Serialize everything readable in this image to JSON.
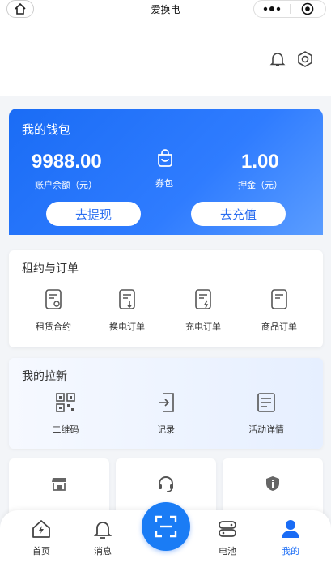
{
  "navbar": {
    "title": "爱换电"
  },
  "wallet": {
    "title": "我的钱包",
    "balance_value": "9988.00",
    "balance_label": "账户余额（元）",
    "coupon_label": "券包",
    "deposit_value": "1.00",
    "deposit_label": "押金（元）",
    "withdraw_label": "去提现",
    "recharge_label": "去充值"
  },
  "orders": {
    "title": "租约与订单",
    "items": [
      {
        "label": "租赁合约",
        "icon": "contract-icon"
      },
      {
        "label": "换电订单",
        "icon": "swap-order-icon"
      },
      {
        "label": "充电订单",
        "icon": "charge-order-icon"
      },
      {
        "label": "商品订单",
        "icon": "goods-order-icon"
      }
    ]
  },
  "invite": {
    "title": "我的拉新",
    "items": [
      {
        "label": "二维码",
        "icon": "qrcode-icon"
      },
      {
        "label": "记录",
        "icon": "record-icon"
      },
      {
        "label": "活动详情",
        "icon": "activity-detail-icon"
      }
    ]
  },
  "shortcuts": [
    {
      "icon": "store-icon"
    },
    {
      "icon": "headset-icon"
    },
    {
      "icon": "info-icon"
    }
  ],
  "tabbar": {
    "items": [
      {
        "label": "首页",
        "icon": "home-icon"
      },
      {
        "label": "消息",
        "icon": "bell-icon"
      },
      {
        "label": "电池",
        "icon": "battery-icon"
      },
      {
        "label": "我的",
        "icon": "user-icon",
        "active": true
      }
    ],
    "scan_icon": "scan-icon"
  },
  "colors": {
    "primary": "#1a6cf5",
    "background": "#f3f5f8"
  }
}
